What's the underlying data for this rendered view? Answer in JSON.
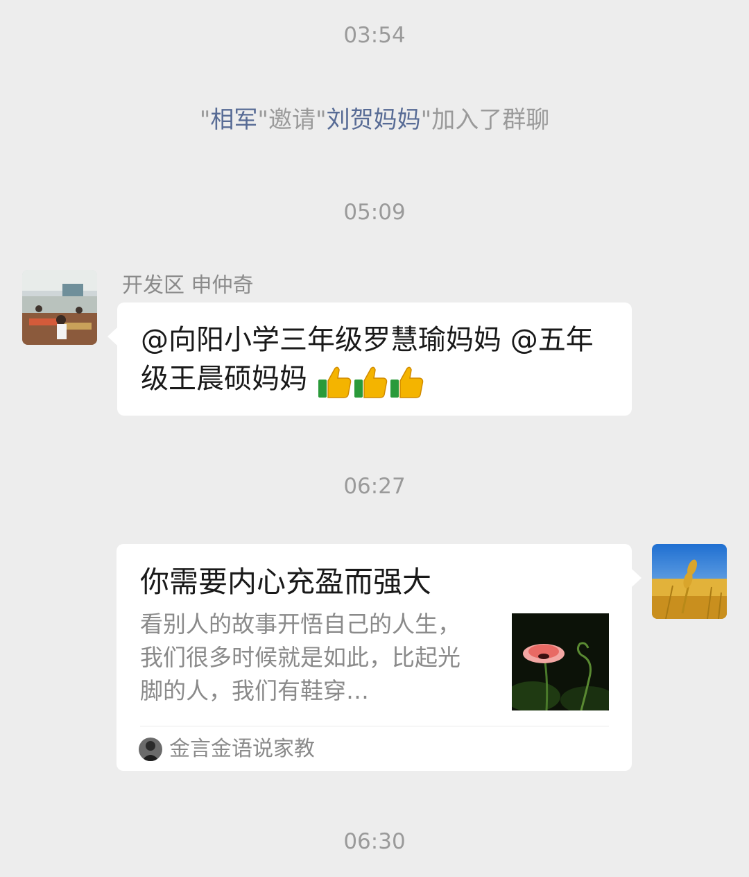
{
  "timestamps": [
    "03:54",
    "05:09",
    "06:27",
    "06:30"
  ],
  "system_message": {
    "quote_open": "\"",
    "inviter": "相军",
    "mid": "\"邀请\"",
    "invitee": "刘贺妈妈",
    "tail": "\"加入了群聊"
  },
  "incoming_message": {
    "sender": "开发区 申仲奇",
    "text": "@向阳小学三年级罗慧瑜妈妈 @五年级王晨硕妈妈",
    "emoji_icons": [
      "thumbs-up-icon",
      "thumbs-up-icon",
      "thumbs-up-icon"
    ]
  },
  "shared_link": {
    "title": "你需要内心充盈而强大",
    "description": "看别人的故事开悟自己的人生，我们很多时候就是如此，比起光脚的人，我们有鞋穿…",
    "source": "金言金语说家教"
  },
  "colors": {
    "background": "#ededed",
    "bubble": "#ffffff",
    "link_highlight": "#576b95",
    "muted_text": "#9a9a9a"
  }
}
